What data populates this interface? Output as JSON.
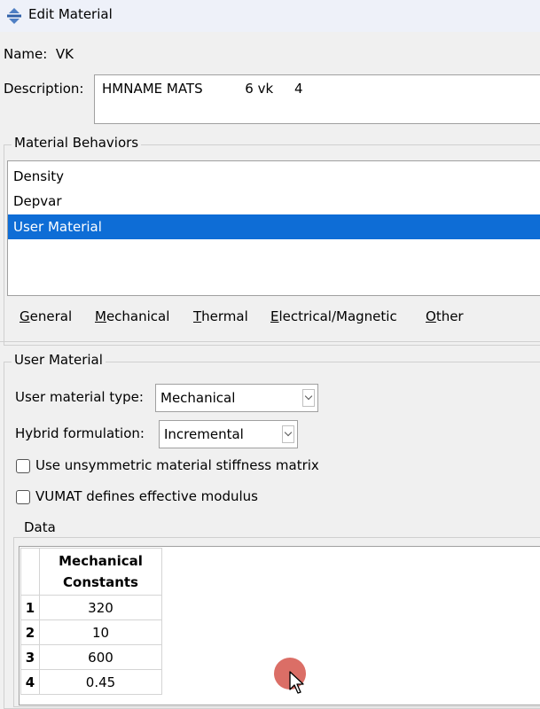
{
  "window": {
    "title": "Edit Material"
  },
  "name": {
    "label": "Name:",
    "value": "VK"
  },
  "description": {
    "label": "Description:",
    "value": "HMNAME MATS          6 vk     4"
  },
  "material_behaviors": {
    "title": "Material Behaviors",
    "items": [
      "Density",
      "Depvar",
      "User Material"
    ],
    "selected_index": 2
  },
  "menu": {
    "items": [
      {
        "mnemonic": "G",
        "rest": "eneral"
      },
      {
        "mnemonic": "M",
        "rest": "echanical"
      },
      {
        "mnemonic": "T",
        "rest": "hermal"
      },
      {
        "mnemonic": "E",
        "rest": "lectrical/Magnetic"
      },
      {
        "mnemonic": "O",
        "rest": "ther"
      }
    ]
  },
  "user_material": {
    "title": "User Material",
    "type_label": "User material type:",
    "type_value": "Mechanical",
    "hybrid_label": "Hybrid formulation:",
    "hybrid_value": "Incremental",
    "unsym_label": "Use unsymmetric material stiffness matrix",
    "unsym_checked": false,
    "vumat_label": "VUMAT defines effective modulus",
    "vumat_checked": false
  },
  "data": {
    "title": "Data",
    "column_header_line1": "Mechanical",
    "column_header_line2": "Constants",
    "rows": [
      {
        "index": "1",
        "value": "320"
      },
      {
        "index": "2",
        "value": "10"
      },
      {
        "index": "3",
        "value": "600"
      },
      {
        "index": "4",
        "value": "0.45"
      }
    ]
  },
  "colors": {
    "selection": "#0e6dd6",
    "cursor_highlight": "#d9665e"
  }
}
